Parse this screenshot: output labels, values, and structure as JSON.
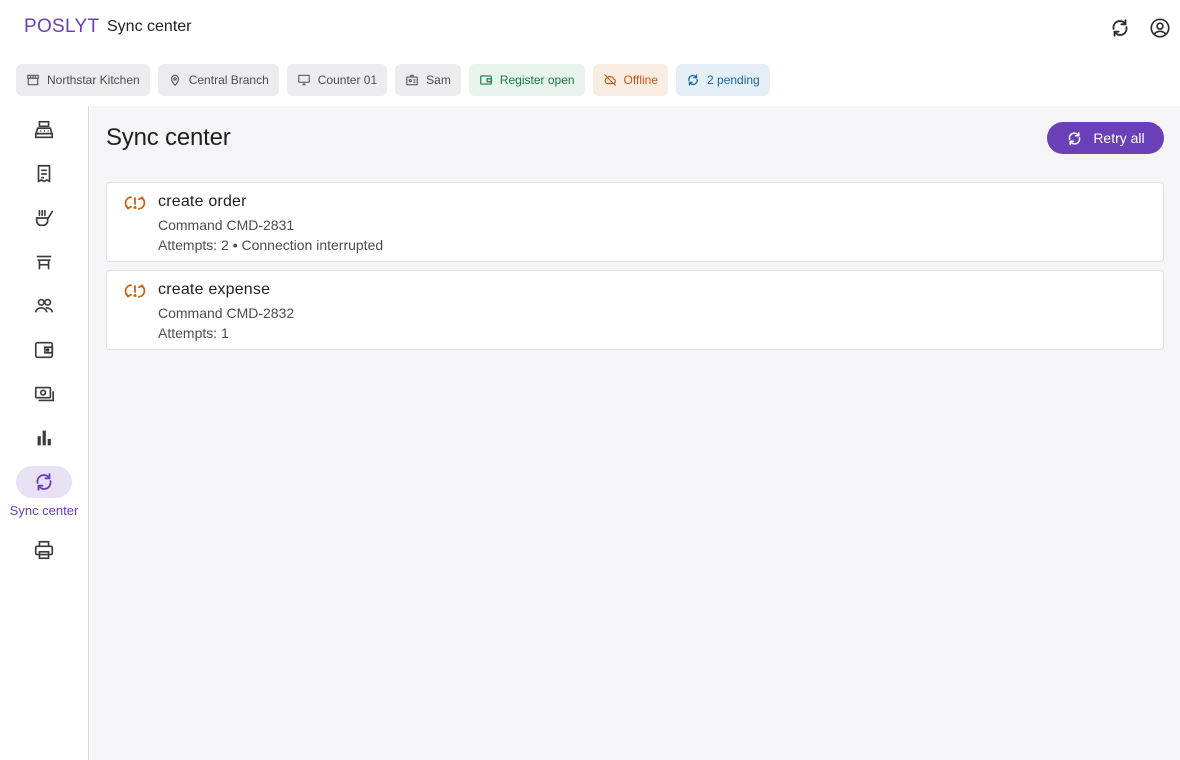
{
  "header": {
    "brand": "POSLYT",
    "title": "Sync center"
  },
  "chips": [
    {
      "label": "Northstar Kitchen",
      "icon": "store-icon"
    },
    {
      "label": "Central Branch",
      "icon": "location-pin-icon"
    },
    {
      "label": "Counter 01",
      "icon": "monitor-icon"
    },
    {
      "label": "Sam",
      "icon": "badge-icon"
    },
    {
      "label": "Register open",
      "icon": "wallet-icon"
    },
    {
      "label": "Offline",
      "icon": "cloud-off-icon"
    },
    {
      "label": "2 pending",
      "icon": "sync-icon"
    }
  ],
  "sidebar": {
    "items": [
      {
        "icon": "register-icon"
      },
      {
        "icon": "receipt-icon"
      },
      {
        "icon": "kitchen-icon"
      },
      {
        "icon": "table-icon"
      },
      {
        "icon": "users-icon"
      },
      {
        "icon": "wallet-icon"
      },
      {
        "icon": "payments-icon"
      },
      {
        "icon": "chart-icon"
      },
      {
        "icon": "sync-icon",
        "label": "Sync center",
        "active": true
      },
      {
        "icon": "printer-icon"
      }
    ]
  },
  "main": {
    "title": "Sync center",
    "retry_label": "Retry all",
    "commands": [
      {
        "title": "create order",
        "command": "Command CMD-2831",
        "attempts": "Attempts: 2",
        "separator": " • ",
        "error": "Connection interrupted"
      },
      {
        "title": "create expense",
        "command": "Command CMD-2832",
        "attempts": "Attempts: 1",
        "separator": "",
        "error": ""
      }
    ]
  },
  "colors": {
    "accent": "#6b3fb8",
    "success": "#17794a",
    "warning": "#bd5a12",
    "info": "#1b63a3",
    "sync_error": "#c8650f"
  }
}
